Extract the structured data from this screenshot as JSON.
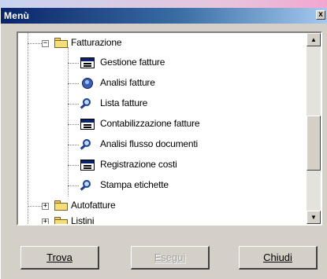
{
  "window": {
    "title": "Menù",
    "close_symbol": "x"
  },
  "tree": {
    "parent_nodes": [
      {
        "label": "Fatturazione",
        "expander": "−",
        "expanded": true
      },
      {
        "label": "Autofatture",
        "expander": "+",
        "expanded": false
      },
      {
        "label": "Listini",
        "expander": "+",
        "expanded": false
      }
    ],
    "children": [
      {
        "label": "Gestione fatture",
        "icon": "window-icon"
      },
      {
        "label": "Analisi fatture",
        "icon": "disk-chart-icon"
      },
      {
        "label": "Lista fatture",
        "icon": "search-icon"
      },
      {
        "label": "Contabilizzazione fatture",
        "icon": "window-icon"
      },
      {
        "label": "Analisi flusso documenti",
        "icon": "search-icon"
      },
      {
        "label": "Registrazione costi",
        "icon": "window-icon"
      },
      {
        "label": "Stampa etichette",
        "icon": "search-icon"
      }
    ]
  },
  "scrollbar": {
    "up_arrow": "▲",
    "down_arrow": "▼"
  },
  "buttons": {
    "find": "Trova",
    "run": "Esegui",
    "close": "Chiudi"
  }
}
